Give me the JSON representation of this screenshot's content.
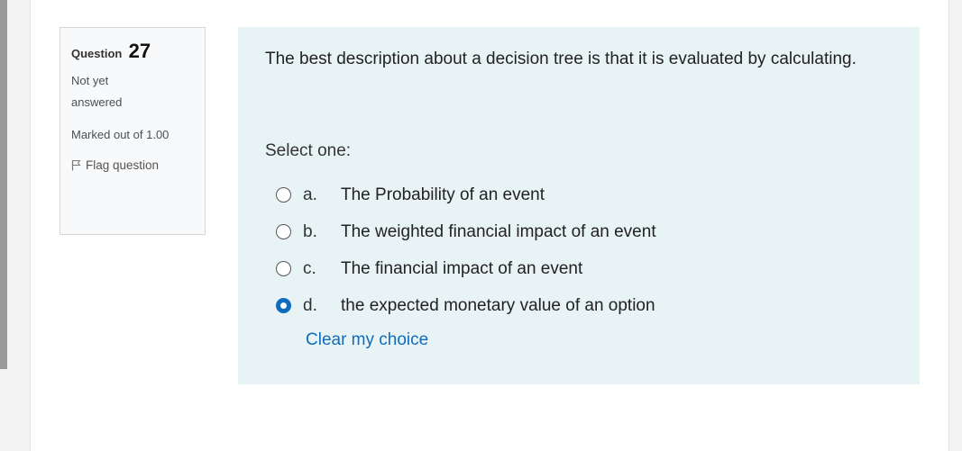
{
  "question": {
    "label": "Question",
    "number": "27",
    "state": "Not yet answered",
    "grade": "Marked out of 1.00",
    "flag_label": "Flag question",
    "text": "The best description about a decision tree is that it is evaluated by calculating.",
    "prompt": "Select one:",
    "options": [
      {
        "letter": "a.",
        "text": "The Probability of an event",
        "selected": false
      },
      {
        "letter": "b.",
        "text": "The weighted financial impact of an event",
        "selected": false
      },
      {
        "letter": "c.",
        "text": "The financial impact of an event",
        "selected": false
      },
      {
        "letter": "d.",
        "text": "the expected monetary value of an option",
        "selected": true
      }
    ],
    "clear_label": "Clear my choice"
  },
  "icons": {
    "flag": "flag-icon",
    "radio": "radio-button"
  },
  "colors": {
    "accent": "#0f6cbf",
    "formulation_bg": "#e7f3f5",
    "info_bg": "#f8f9fa"
  }
}
